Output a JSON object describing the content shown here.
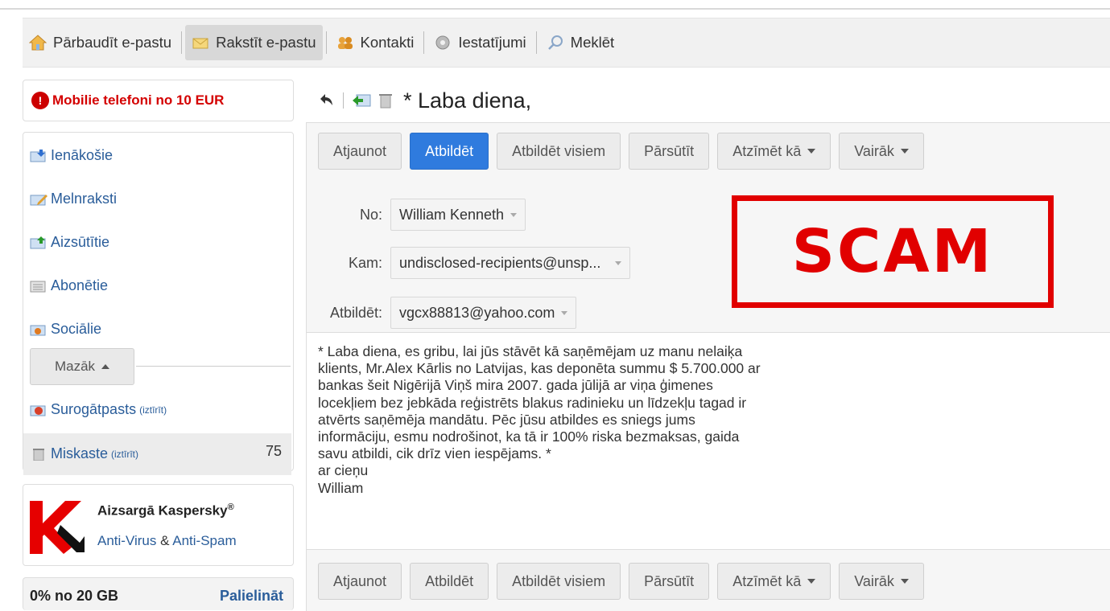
{
  "toolbar": {
    "check_mail": "Pārbaudīt e-pastu",
    "compose": "Rakstīt e-pastu",
    "contacts": "Kontakti",
    "settings": "Iestatījumi",
    "search": "Meklēt"
  },
  "sidebar": {
    "promo": {
      "badge": "!",
      "text": "Mobilie telefoni no 10 EUR"
    },
    "folders": [
      {
        "label": "Ienākošie"
      },
      {
        "label": "Melnraksti"
      },
      {
        "label": "Aizsūtītie"
      },
      {
        "label": "Abonētie"
      },
      {
        "label": "Sociālie"
      }
    ],
    "less_button": "Mazāk",
    "spam": {
      "label": "Surogātpasts",
      "clean": "(iztīrīt)"
    },
    "trash": {
      "label": "Miskaste",
      "clean": "(iztīrīt)",
      "count": "75"
    },
    "kaspersky": {
      "title": "Aizsargā Kaspersky",
      "reg": "®",
      "anti_virus": "Anti-Virus",
      "amp": "&",
      "anti_spam": "Anti-Spam"
    },
    "quota": {
      "text": "0% no 20 GB",
      "upgrade": "Palielināt"
    }
  },
  "message": {
    "subject": "* Laba diena,",
    "actions": {
      "refresh": "Atjaunot",
      "reply": "Atbildēt",
      "reply_all": "Atbildēt visiem",
      "forward": "Pārsūtīt",
      "mark_as": "Atzīmēt kā",
      "more": "Vairāk"
    },
    "from_label": "No:",
    "from_value": "William Kenneth",
    "to_label": "Kam:",
    "to_value": "undisclosed-recipients@unsp...",
    "reply_to_label": "Atbildēt:",
    "reply_to_value": "vgcx88813@yahoo.com",
    "stamp": "SCAM",
    "body": "* Laba diena, es gribu, lai jūs stāvēt kā saņēmējam uz manu nelaiķa\nklients, Mr.Alex Kārlis no Latvijas, kas deponēta summu $ 5.700.000 ar\nbankas šeit Nigērijā Viņš mira 2007. gada jūlijā ar viņa ģimenes\nlocekļiem bez jebkāda reģistrēts blakus radinieku un līdzekļu tagad ir\natvērts saņēmēja mandātu. Pēc jūsu atbildes es sniegs jums\ninformāciju, esmu nodrošinot, ka tā ir 100% riska bezmaksas, gaida\nsavu atbildi, cik drīz vien iespējams. *\nar cieņu\nWilliam"
  },
  "colors": {
    "accent": "#2f7bde",
    "stamp": "#e10000",
    "promo": "#d40000",
    "link": "#2a5d9a"
  }
}
